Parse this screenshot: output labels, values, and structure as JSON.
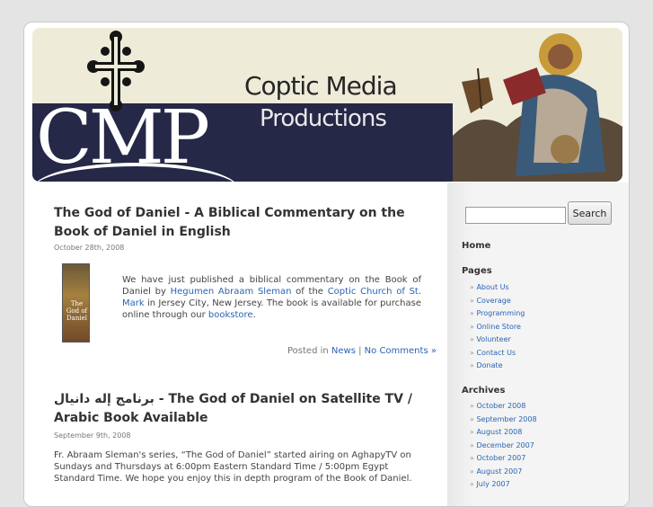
{
  "header": {
    "title_line1": "Coptic Media",
    "title_line2": "Productions",
    "logo_text": "CMP"
  },
  "posts": [
    {
      "title": "The God of Daniel - A Biblical Commentary on the Book of Daniel in English",
      "date": "October 28th, 2008",
      "thumb_text": "The God of Daniel",
      "body_1": "We have just published a biblical commentary on the Book of Daniel by ",
      "link_author": "Hegumen Abraam Sleman",
      "body_2": " of the ",
      "link_church": "Coptic Church of St. Mark",
      "body_3": " in Jersey City, New Jersey. The book is available for purchase online through our ",
      "link_store": "bookstore",
      "body_4": ".",
      "posted_in_label": "Posted in ",
      "category": "News",
      "separator": " | ",
      "comments": "No Comments »"
    },
    {
      "title_arabic": "برنامج إله دانيال",
      "title": "  - The God of Daniel on Satellite TV / Arabic Book Available",
      "date": "September 9th, 2008",
      "body": "Fr. Abraam Sleman's series, “The God of Daniel” started airing on AghapyTV on Sundays and Thursdays at 6:00pm Eastern Standard Time / 5:00pm Egypt Standard Time. We hope you enjoy this in depth program of the Book of Daniel."
    }
  ],
  "sidebar": {
    "search_button": "Search",
    "search_value": "",
    "home": "Home",
    "pages_heading": "Pages",
    "pages": [
      "About Us",
      "Coverage",
      "Programming",
      "Online Store",
      "Volunteer",
      "Contact Us",
      "Donate"
    ],
    "archives_heading": "Archives",
    "archives": [
      "October 2008",
      "September 2008",
      "August 2008",
      "December 2007",
      "October 2007",
      "August 2007",
      "July 2007"
    ]
  }
}
